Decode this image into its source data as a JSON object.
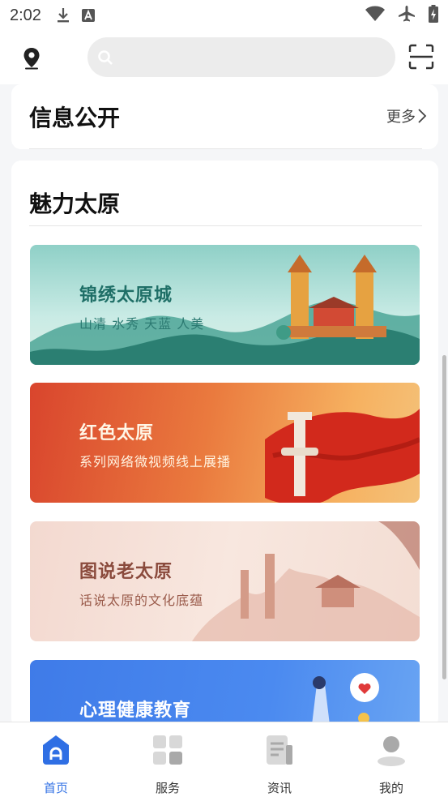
{
  "status_bar": {
    "time": "2:02"
  },
  "header": {
    "search_placeholder": ""
  },
  "info_card": {
    "title": "信息公开",
    "more_label": "更多"
  },
  "charm_card": {
    "title": "魅力太原",
    "banners": [
      {
        "title": "锦绣太原城",
        "subtitle": "山清 水秀 天蓝 人美"
      },
      {
        "title": "红色太原",
        "subtitle": "系列网络微视频线上展播"
      },
      {
        "title": "图说老太原",
        "subtitle": "话说太原的文化底蕴"
      },
      {
        "title": "心理健康教育",
        "subtitle": ""
      }
    ]
  },
  "bottom_nav": {
    "items": [
      {
        "label": "首页",
        "icon": "home-icon",
        "active": true
      },
      {
        "label": "服务",
        "icon": "grid-icon",
        "active": false
      },
      {
        "label": "资讯",
        "icon": "news-icon",
        "active": false
      },
      {
        "label": "我的",
        "icon": "user-icon",
        "active": false
      }
    ]
  },
  "colors": {
    "accent": "#2f6fe4",
    "page_bg": "#f5f6f8"
  }
}
